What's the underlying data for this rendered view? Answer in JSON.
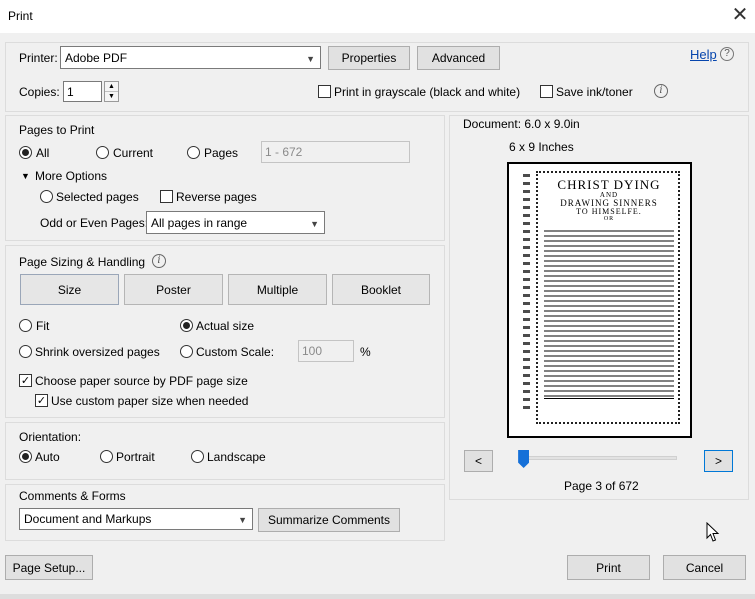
{
  "window": {
    "title": "Print",
    "close_glyph": "✕"
  },
  "printer": {
    "label": "Printer:",
    "selected": "Adobe PDF",
    "properties_label": "Properties",
    "advanced_label": "Advanced",
    "help_label": "Help",
    "help_glyph": "?"
  },
  "copies": {
    "label": "Copies:",
    "value": "1",
    "grayscale_label": "Print in grayscale (black and white)",
    "grayscale_checked": false,
    "save_ink_label": "Save ink/toner",
    "save_ink_checked": false,
    "info_glyph": "i"
  },
  "pages_to_print": {
    "title": "Pages to Print",
    "all_label": "All",
    "current_label": "Current",
    "pages_label": "Pages",
    "pages_range": "1 - 672",
    "more_options_label": "More Options",
    "selected_pages_label": "Selected pages",
    "reverse_pages_label": "Reverse pages",
    "odd_even_label": "Odd or Even Pages:",
    "odd_even_selected": "All pages in range"
  },
  "sizing": {
    "title": "Page Sizing & Handling",
    "info_glyph": "i",
    "size_label": "Size",
    "poster_label": "Poster",
    "multiple_label": "Multiple",
    "booklet_label": "Booklet",
    "fit_label": "Fit",
    "actual_size_label": "Actual size",
    "shrink_label": "Shrink oversized pages",
    "custom_scale_label": "Custom Scale:",
    "custom_scale_value": "100",
    "percent_label": "%",
    "paper_source_label": "Choose paper source by PDF page size",
    "custom_paper_label": "Use custom paper size when needed"
  },
  "orientation": {
    "title": "Orientation:",
    "auto_label": "Auto",
    "portrait_label": "Portrait",
    "landscape_label": "Landscape"
  },
  "comments": {
    "title": "Comments & Forms",
    "selected": "Document and Markups",
    "summarize_label": "Summarize Comments"
  },
  "preview": {
    "document_size": "Document: 6.0 x 9.0in",
    "paper_size": "6 x 9 Inches",
    "prev_label": "<",
    "next_label": ">",
    "page_status": "Page 3 of 672",
    "slider_position": 0.02,
    "doc_text": {
      "line1": "CHRIST DYING",
      "line2": "AND",
      "line3": "DRAWING SINNERS",
      "line4": "TO HIMSELFE.",
      "line5": "OR"
    }
  },
  "footer": {
    "page_setup_label": "Page Setup...",
    "print_label": "Print",
    "cancel_label": "Cancel"
  }
}
